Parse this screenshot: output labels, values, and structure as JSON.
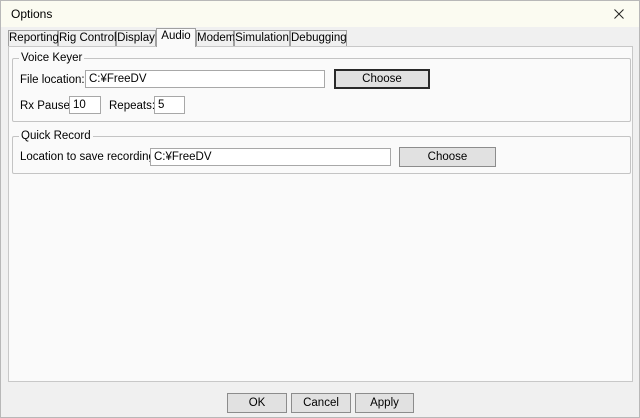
{
  "window": {
    "title": "Options"
  },
  "tabs": [
    {
      "label": "Reporting",
      "active": false
    },
    {
      "label": "Rig Control",
      "active": false
    },
    {
      "label": "Display",
      "active": false
    },
    {
      "label": "Audio",
      "active": true
    },
    {
      "label": "Modem",
      "active": false
    },
    {
      "label": "Simulation",
      "active": false
    },
    {
      "label": "Debugging",
      "active": false
    }
  ],
  "voice_keyer": {
    "group_label": "Voice Keyer",
    "file_location_label": "File location:",
    "file_location_value": "C:¥FreeDV",
    "choose_label": "Choose",
    "rx_pause_label": "Rx Pause:",
    "rx_pause_value": "10",
    "repeats_label": "Repeats:",
    "repeats_value": "5"
  },
  "quick_record": {
    "group_label": "Quick Record",
    "location_label": "Location to save recordings:",
    "location_value": "C:¥FreeDV",
    "choose_label": "Choose"
  },
  "footer": {
    "ok_label": "OK",
    "cancel_label": "Cancel",
    "apply_label": "Apply"
  },
  "icons": {
    "close": "close-icon"
  }
}
